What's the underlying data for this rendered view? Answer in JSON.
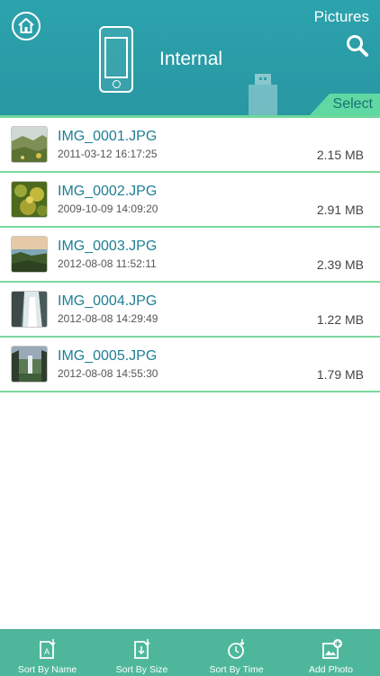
{
  "header": {
    "title": "Pictures",
    "storage_label": "Internal",
    "select_label": "Select",
    "home_icon": "home-icon",
    "search_icon": "search-icon",
    "device_icon": "phone-icon",
    "usb_icon": "usb-drive-icon"
  },
  "files": [
    {
      "name": "IMG_0001.JPG",
      "date": "2011-03-12 16:17:25",
      "size": "2.15 MB",
      "thumb": "landscape-thumbnail"
    },
    {
      "name": "IMG_0002.JPG",
      "date": "2009-10-09 14:09:20",
      "size": "2.91 MB",
      "thumb": "flower-thumbnail"
    },
    {
      "name": "IMG_0003.JPG",
      "date": "2012-08-08 11:52:11",
      "size": "2.39 MB",
      "thumb": "coast-thumbnail"
    },
    {
      "name": "IMG_0004.JPG",
      "date": "2012-08-08 14:29:49",
      "size": "1.22 MB",
      "thumb": "waterfall-thumbnail"
    },
    {
      "name": "IMG_0005.JPG",
      "date": "2012-08-08 14:55:30",
      "size": "1.79 MB",
      "thumb": "valley-thumbnail"
    }
  ],
  "toolbar": {
    "sort_name": "Sort By Name",
    "sort_size": "Sort By Size",
    "sort_time": "Sort By Time",
    "add_photo": "Add Photo"
  },
  "colors": {
    "header": "#2ca3ad",
    "accent_green": "#5fd8a2",
    "divider": "#7ad89b",
    "toolbar": "#4eb79b",
    "filename": "#1e7f93"
  }
}
